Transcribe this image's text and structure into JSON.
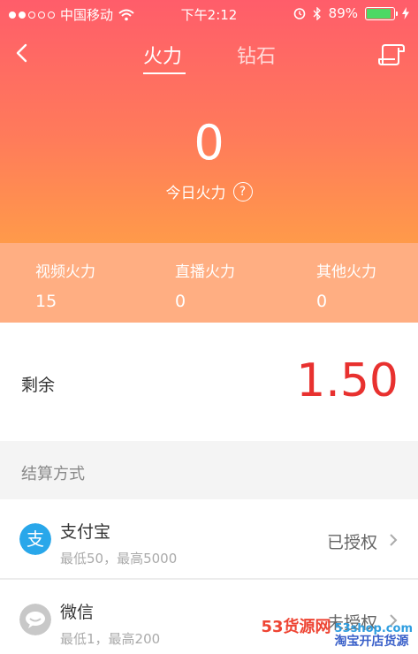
{
  "status_bar": {
    "carrier": "中国移动",
    "time": "下午2:12",
    "battery": "89%",
    "battery_level": 0.89
  },
  "nav": {
    "tabs": [
      "火力",
      "钻石"
    ],
    "active_tab": "火力"
  },
  "hero": {
    "value": "0",
    "label": "今日火力",
    "help": "?"
  },
  "stats": [
    {
      "label": "视频火力",
      "value": "15"
    },
    {
      "label": "直播火力",
      "value": "0"
    },
    {
      "label": "其他火力",
      "value": "0"
    }
  ],
  "balance": {
    "label": "剩余",
    "value": "1.50"
  },
  "settlement": {
    "title": "结算方式",
    "methods": [
      {
        "name": "支付宝",
        "limit": "最低50，最高5000",
        "status": "已授权",
        "icon": "alipay-icon"
      },
      {
        "name": "微信",
        "limit": "最低1，最高200",
        "status": "未授权",
        "icon": "wechat-icon"
      }
    ]
  },
  "colors": {
    "gradient_top": "#ff5d6a",
    "gradient_bottom": "#ff9a4a",
    "stats_bg": "#ffae82",
    "balance_red": "#e8312f",
    "alipay_blue": "#29a7ea"
  },
  "watermark": {
    "brand": "53货源网",
    "domain": "53shop.com",
    "slogan": "淘宝开店货源"
  }
}
